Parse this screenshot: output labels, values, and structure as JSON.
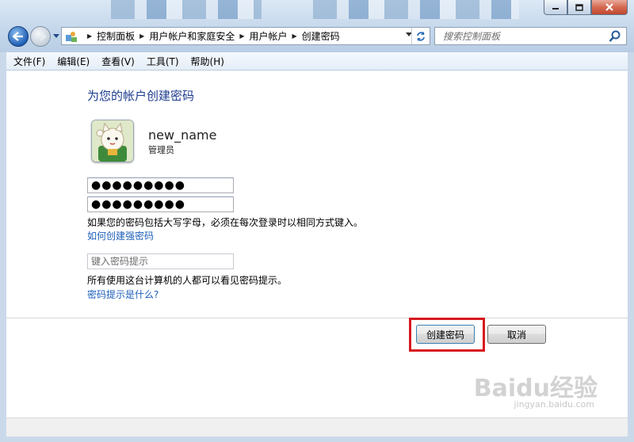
{
  "window": {
    "minimize_icon": "minimize-icon",
    "maximize_icon": "maximize-icon",
    "close_icon": "close-icon"
  },
  "address_bar": {
    "breadcrumbs": [
      "控制面板",
      "用户帐户和家庭安全",
      "用户帐户",
      "创建密码"
    ]
  },
  "search": {
    "placeholder": "搜索控制面板"
  },
  "menu": {
    "items": [
      "文件(F)",
      "编辑(E)",
      "查看(V)",
      "工具(T)",
      "帮助(H)"
    ]
  },
  "page": {
    "title": "为您的帐户创建密码",
    "user": {
      "name": "new_name",
      "role": "管理员"
    },
    "password_value": "●●●●●●●●●",
    "confirm_value": "●●●●●●●●●",
    "caps_note": "如果您的密码包括大写字母，必须在每次登录时以相同方式键入。",
    "strong_link": "如何创建强密码",
    "hint_placeholder": "键入密码提示",
    "hint_note": "所有使用这台计算机的人都可以看见密码提示。",
    "hint_link": "密码提示是什么?",
    "create_button": "创建密码",
    "cancel_button": "取消"
  },
  "watermark": {
    "text": "Baidu经验",
    "sub": "jingyan.baidu.com"
  },
  "colors": {
    "title": "#1e3d8f",
    "link": "#1e5fb8",
    "highlight": "#d71920"
  }
}
